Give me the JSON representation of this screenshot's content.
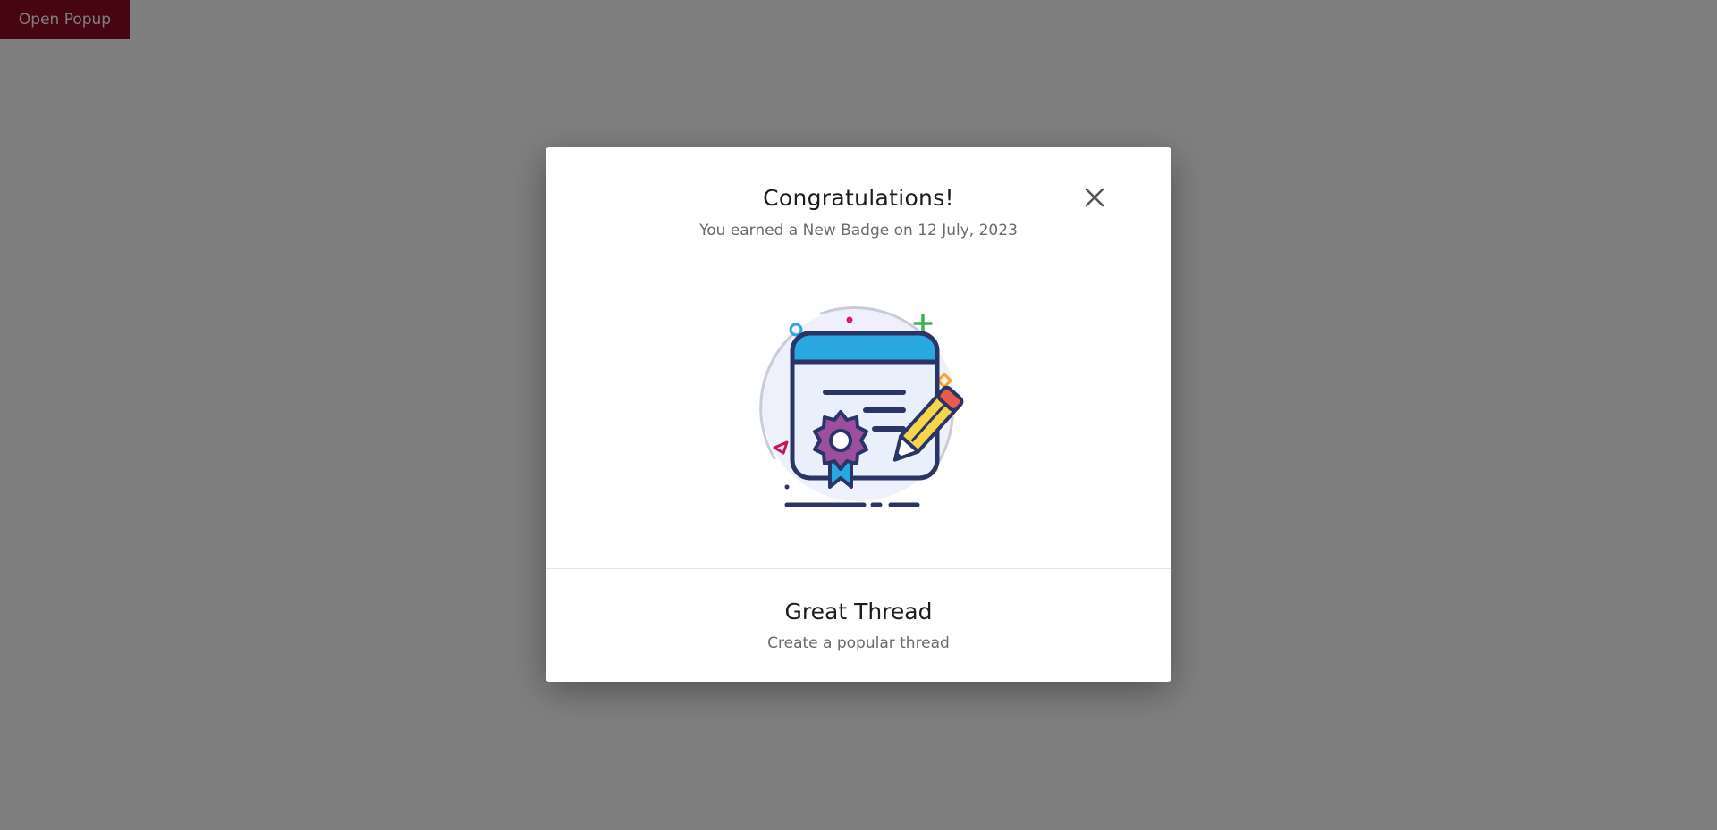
{
  "page": {
    "open_button_label": "Open Popup"
  },
  "modal": {
    "title": "Congratulations!",
    "subtitle": "You earned a New Badge on 12 July, 2023",
    "close_icon": "close-icon",
    "illustration_icon": "certificate-badge-icon",
    "badge_name": "Great Thread",
    "badge_description": "Create a popular thread"
  },
  "colors": {
    "open_button_bg": "#8b0a22",
    "overlay": "rgba(0,0,0,0.5)",
    "certificate_header": "#29a8e0",
    "outline": "#2b3466",
    "seal": "#9b4f9e",
    "pencil": "#f5d54a",
    "pencil_eraser": "#e85b4f"
  }
}
